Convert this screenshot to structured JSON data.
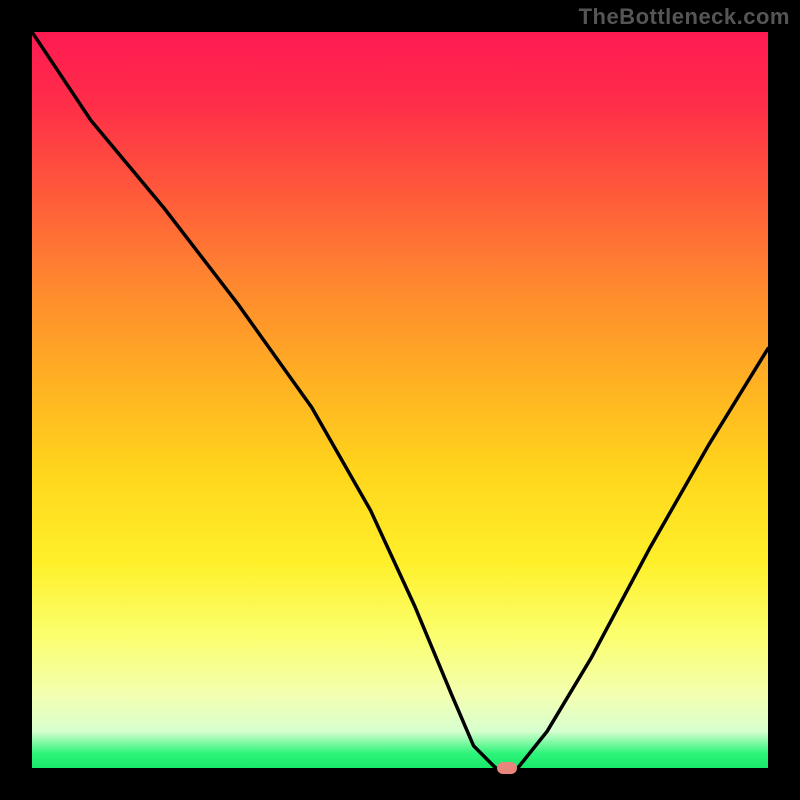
{
  "watermark": "TheBottleneck.com",
  "colors": {
    "frame": "#000000",
    "curve": "#000000",
    "marker": "#e8857d",
    "gradient_top": "#ff1a52",
    "gradient_bottom": "#18e96a"
  },
  "chart_data": {
    "type": "line",
    "title": "",
    "xlabel": "",
    "ylabel": "",
    "xlim": [
      0,
      100
    ],
    "ylim": [
      0,
      100
    ],
    "grid": false,
    "legend": null,
    "annotations": [
      {
        "text": "TheBottleneck.com",
        "position": "top-right"
      }
    ],
    "series": [
      {
        "name": "bottleneck-curve",
        "x": [
          0,
          8,
          18,
          28,
          38,
          46,
          52,
          57,
          60,
          63,
          66,
          70,
          76,
          84,
          92,
          100
        ],
        "values": [
          100,
          88,
          76,
          63,
          49,
          35,
          22,
          10,
          3,
          0,
          0,
          5,
          15,
          30,
          44,
          57
        ]
      }
    ],
    "marker": {
      "x": 64.5,
      "y": 0,
      "shape": "rounded-pill",
      "color": "#e8857d"
    },
    "background_gradient": {
      "direction": "vertical",
      "stops": [
        {
          "pos": 0.0,
          "color": "#ff1a52"
        },
        {
          "pos": 0.35,
          "color": "#ff8a2e"
        },
        {
          "pos": 0.6,
          "color": "#ffd61c"
        },
        {
          "pos": 0.82,
          "color": "#fbff6e"
        },
        {
          "pos": 0.95,
          "color": "#d7ffcf"
        },
        {
          "pos": 1.0,
          "color": "#18e96a"
        }
      ]
    }
  }
}
